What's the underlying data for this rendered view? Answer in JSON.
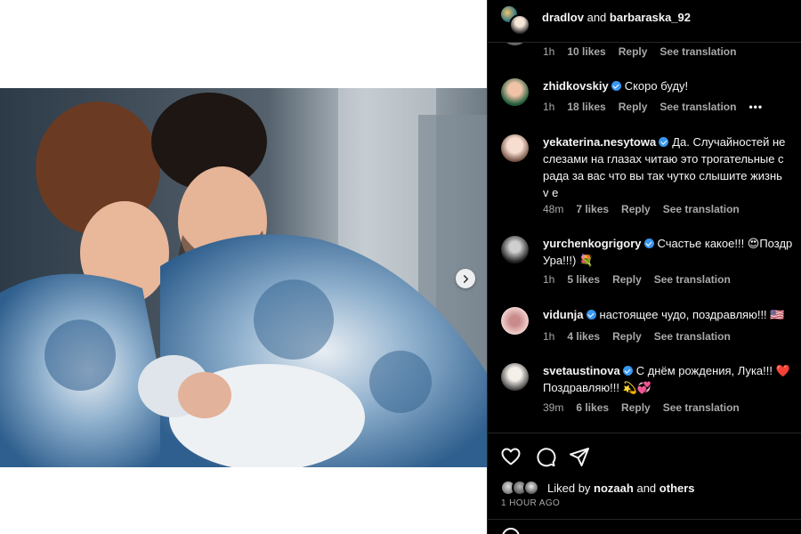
{
  "header": {
    "user1": "dradlov",
    "joiner": "and",
    "user2": "barbaraska_92"
  },
  "comments": [
    {
      "text_lines": [],
      "time": "1h",
      "likes": "10 likes",
      "reply": "Reply",
      "translate": "See translation"
    },
    {
      "username": "zhidkovskiy",
      "verified": true,
      "text": "Скоро буду!",
      "time": "1h",
      "likes": "18 likes",
      "reply": "Reply",
      "translate": "See translation",
      "more": "•••"
    },
    {
      "username": "yekaterina.nesytowa",
      "verified": true,
      "text": "Да. Случайностей не",
      "text_lines": [
        "слезами на глазах читаю это трогательные с",
        "рада за вас что вы так чутко слышите жизнь",
        "v e"
      ],
      "time": "48m",
      "likes": "7 likes",
      "reply": "Reply",
      "translate": "See translation"
    },
    {
      "username": "yurchenkogrigory",
      "verified": true,
      "text": "Счастье какое!!! 😍Поздр",
      "text_lines": [
        "Ура!!!) 💐"
      ],
      "time": "1h",
      "likes": "5 likes",
      "reply": "Reply",
      "translate": "See translation"
    },
    {
      "username": "vidunja",
      "verified": true,
      "text": "настоящее чудо, поздравляю!!! 🇺🇸",
      "time": "1h",
      "likes": "4 likes",
      "reply": "Reply",
      "translate": "See translation"
    },
    {
      "username": "svetaustinova",
      "verified": true,
      "text": "С днём рождения, Лука!!! ❤️",
      "text_lines": [
        "Поздравляю!!! 💫💞"
      ],
      "time": "39m",
      "likes": "6 likes",
      "reply": "Reply",
      "translate": "See translation"
    }
  ],
  "actions": {
    "liked_by_prefix": "Liked by",
    "liked_by_user": "nozaah",
    "liked_by_and": "and",
    "liked_by_others": "others",
    "post_time": "1 HOUR AGO"
  },
  "colors": {
    "panel_bg": "#000000",
    "text_primary": "#f5f5f5",
    "text_secondary": "#a8a8a8",
    "verified_blue": "#3897f0",
    "divider": "#262626"
  },
  "icons": [
    "heart-icon",
    "comment-icon",
    "share-icon",
    "verified-icon",
    "chevron-right-icon",
    "more-icon"
  ]
}
